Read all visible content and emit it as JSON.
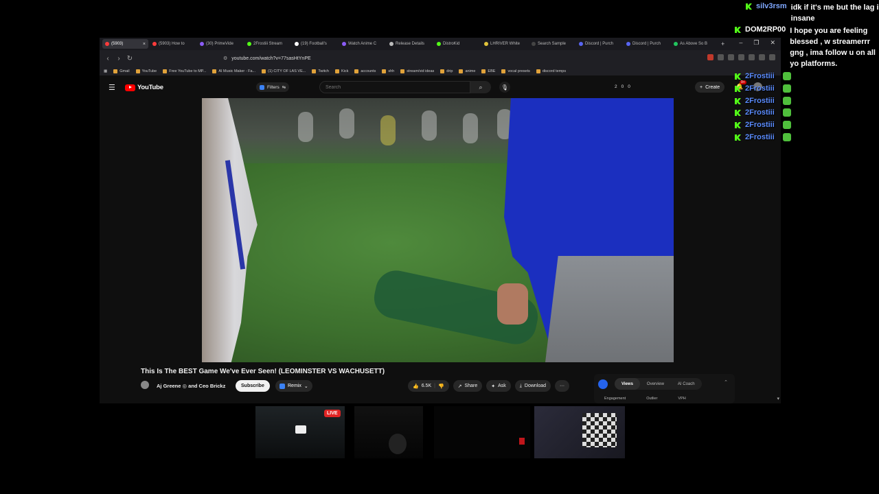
{
  "browser": {
    "tabs": [
      {
        "label": "(5903)",
        "color": "#ff3b3b",
        "active": true
      },
      {
        "label": "(5903) How to",
        "color": "#ff3b3b"
      },
      {
        "label": "(30) PrimeVide",
        "color": "#8b5cf6"
      },
      {
        "label": "2Frostiii Stream",
        "color": "#53fc18"
      },
      {
        "label": "(19) Football's",
        "color": "#ffffff"
      },
      {
        "label": "Watch Anime C",
        "color": "#8b5cf6"
      },
      {
        "label": "Release Details",
        "color": "#bbbbbb"
      },
      {
        "label": "DistroKid",
        "color": "#53fc18"
      },
      {
        "label": "LHRIVER White",
        "color": "#e0c33a"
      },
      {
        "label": "Search Sample",
        "color": "#444444"
      },
      {
        "label": "Discord | Purch",
        "color": "#5865f2"
      },
      {
        "label": "Discord | Purch",
        "color": "#5865f2"
      },
      {
        "label": "As Above So B",
        "color": "#22c55e"
      }
    ],
    "url": "youtube.com/watch?v=77sasHtYnPE",
    "bookmarks": [
      "Gmail",
      "YouTube",
      "Free YouTube to MP...",
      "AI Music Maker - Fa...",
      "(1) CITY OF LAS VE...",
      "Twitch",
      "Kick",
      "accounts",
      "shh",
      "stream/vid ideas",
      "drip",
      "anime",
      "EBE",
      "vocal presets",
      "discord temps"
    ]
  },
  "youtube": {
    "logo_text": "YouTube",
    "filters_label": "Filters",
    "search_placeholder": "Search",
    "header_stats": [
      "2",
      "0",
      "0"
    ],
    "create_label": "Create",
    "notif_badge": "9+",
    "video_title": "This Is The BEST Game We've Ever Seen! (LEOMINSTER VS WACHUSETT)",
    "channel_name": "Aj Greene ◎ and Ceo Brickz",
    "subscribe_label": "Subscribe",
    "remix_label": "Remix",
    "like_count": "6.5K",
    "share_label": "Share",
    "ask_label": "Ask",
    "download_label": "Download",
    "more_label": "···",
    "panel": {
      "tabs": [
        "Views",
        "Overview",
        "AI Coach"
      ],
      "labels": [
        "Engagement",
        "Outlier",
        "VPH"
      ]
    }
  },
  "chat": [
    {
      "user": "silv3rsm",
      "color": "#7fa8ff",
      "text": "idk if it's me but the lag is insane"
    },
    {
      "user": "DOM2RP00",
      "color": "#ffffff",
      "text": "I hope you are feeling blessed , w streamerrr gng , ima follow u on all yo platforms."
    },
    {
      "user": "2Frostiii",
      "color": "#5b8cff",
      "text": ""
    },
    {
      "user": "2Frostiii",
      "color": "#5b8cff",
      "text": ""
    },
    {
      "user": "2Frostiii",
      "color": "#5b8cff",
      "text": ""
    },
    {
      "user": "2Frostiii",
      "color": "#5b8cff",
      "text": ""
    },
    {
      "user": "2Frostiii",
      "color": "#5b8cff",
      "text": ""
    },
    {
      "user": "2Frostiii",
      "color": "#5b8cff",
      "text": ""
    }
  ],
  "cams": {
    "live_label": "LIVE"
  }
}
